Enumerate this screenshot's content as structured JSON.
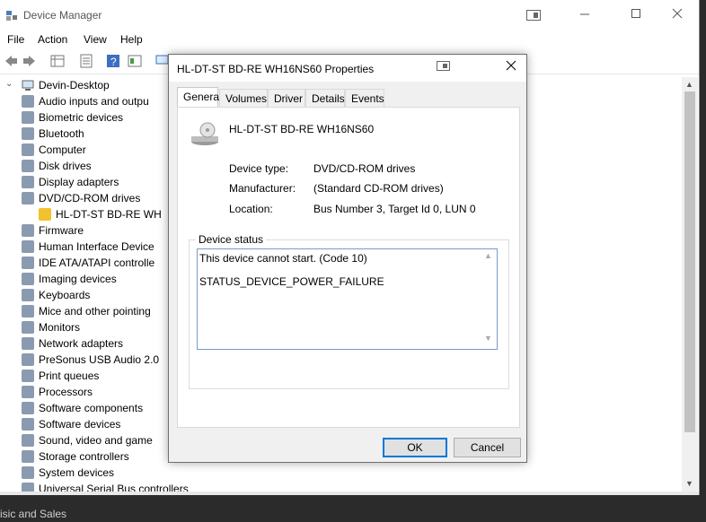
{
  "window": {
    "title": "Device Manager"
  },
  "menu": [
    "File",
    "Action",
    "View",
    "Help"
  ],
  "tree": {
    "root": "Devin-Desktop",
    "items": [
      {
        "label": "Audio inputs and outpu",
        "expanded": false,
        "icon": "speaker-icon"
      },
      {
        "label": "Biometric devices",
        "expanded": false,
        "icon": "fingerprint-icon"
      },
      {
        "label": "Bluetooth",
        "expanded": false,
        "icon": "bluetooth-icon"
      },
      {
        "label": "Computer",
        "expanded": false,
        "icon": "monitor-icon"
      },
      {
        "label": "Disk drives",
        "expanded": false,
        "icon": "disk-icon"
      },
      {
        "label": "Display adapters",
        "expanded": false,
        "icon": "display-adapter-icon"
      },
      {
        "label": "DVD/CD-ROM drives",
        "expanded": true,
        "icon": "dvd-icon"
      },
      {
        "label": "HL-DT-ST BD-RE  WH",
        "child": true,
        "icon": "warning-dvd-icon"
      },
      {
        "label": "Firmware",
        "expanded": false,
        "icon": "chip-icon"
      },
      {
        "label": "Human Interface Device",
        "expanded": false,
        "icon": "hid-icon"
      },
      {
        "label": "IDE ATA/ATAPI controlle",
        "expanded": false,
        "icon": "controller-icon"
      },
      {
        "label": "Imaging devices",
        "expanded": false,
        "icon": "camera-icon"
      },
      {
        "label": "Keyboards",
        "expanded": false,
        "icon": "keyboard-icon"
      },
      {
        "label": "Mice and other pointing",
        "expanded": false,
        "icon": "mouse-icon"
      },
      {
        "label": "Monitors",
        "expanded": false,
        "icon": "monitor-icon"
      },
      {
        "label": "Network adapters",
        "expanded": false,
        "icon": "network-icon"
      },
      {
        "label": "PreSonus USB Audio 2.0",
        "expanded": false,
        "icon": "audio-device-icon"
      },
      {
        "label": "Print queues",
        "expanded": false,
        "icon": "printer-icon"
      },
      {
        "label": "Processors",
        "expanded": false,
        "icon": "cpu-icon"
      },
      {
        "label": "Software components",
        "expanded": false,
        "icon": "puzzle-icon"
      },
      {
        "label": "Software devices",
        "expanded": false,
        "icon": "puzzle-icon"
      },
      {
        "label": "Sound, video and game",
        "expanded": false,
        "icon": "speaker-icon"
      },
      {
        "label": "Storage controllers",
        "expanded": false,
        "icon": "storage-icon"
      },
      {
        "label": "System devices",
        "expanded": false,
        "icon": "system-icon"
      },
      {
        "label": "Universal Serial Bus controllers",
        "expanded": false,
        "icon": "usb-icon"
      }
    ]
  },
  "background_text": "isic and Sales",
  "dialog": {
    "title": "HL-DT-ST BD-RE  WH16NS60 Properties",
    "tabs": [
      "General",
      "Volumes",
      "Driver",
      "Details",
      "Events"
    ],
    "device_name": "HL-DT-ST BD-RE  WH16NS60",
    "device_type_label": "Device type:",
    "device_type": "DVD/CD-ROM drives",
    "manufacturer_label": "Manufacturer:",
    "manufacturer": "(Standard CD-ROM drives)",
    "location_label": "Location:",
    "location": "Bus Number 3, Target Id 0, LUN 0",
    "status_legend": "Device status",
    "status_line1": "This device cannot start. (Code 10)",
    "status_line2": "STATUS_DEVICE_POWER_FAILURE",
    "ok_label": "OK",
    "cancel_label": "Cancel"
  },
  "colors": {
    "accent": "#0078d7",
    "warning": "#f2c12e"
  }
}
